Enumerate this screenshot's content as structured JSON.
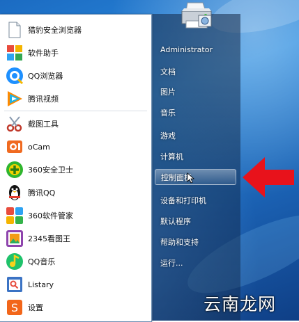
{
  "programs": [
    {
      "label": "猎豹安全浏览器",
      "icon": "cheetah-browser-icon"
    },
    {
      "label": "软件助手",
      "icon": "software-helper-icon"
    },
    {
      "label": "QQ浏览器",
      "icon": "qq-browser-icon"
    },
    {
      "label": "腾讯视频",
      "icon": "tencent-video-icon"
    },
    {
      "label": "截图工具",
      "icon": "snipping-tool-icon"
    },
    {
      "label": "oCam",
      "icon": "ocam-icon"
    },
    {
      "label": "360安全卫士",
      "icon": "360-security-icon"
    },
    {
      "label": "腾讯QQ",
      "icon": "qq-penguin-icon"
    },
    {
      "label": "360软件管家",
      "icon": "360-software-manager-icon"
    },
    {
      "label": "2345看图王",
      "icon": "2345-image-viewer-icon"
    },
    {
      "label": "QQ音乐",
      "icon": "qq-music-icon"
    },
    {
      "label": "Listary",
      "icon": "listary-icon"
    },
    {
      "label": "设置",
      "icon": "settings-icon"
    }
  ],
  "right_links": [
    "Administrator",
    "文档",
    "图片",
    "音乐",
    "游戏",
    "计算机",
    "控制面板",
    "设备和打印机",
    "默认程序",
    "帮助和支持",
    "运行..."
  ],
  "highlighted_item": "控制面板",
  "watermark": "云南龙网",
  "colors": {
    "arrow": "#e8121b",
    "panel_left": "#ffffff",
    "desktop": "#2e8ee0"
  }
}
